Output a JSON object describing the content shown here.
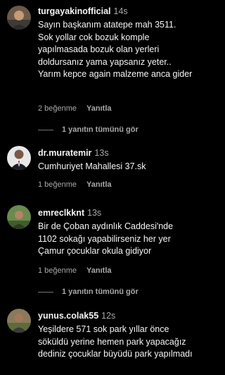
{
  "comments": [
    {
      "username": "turgayakinofficial",
      "time": "14s",
      "text": "Sayın başkanım atatepe mah 3511. Sok yollar cok bozuk komple yapılmasada bozuk olan yerleri doldursanız yama yapsanız yeter.. Yarım kepce again malzeme anca gider",
      "likes": "2 beğenme",
      "reply": "Yanıtla",
      "view_replies": "1 yanıtın tümünü gör"
    },
    {
      "username": "dr.muratemir",
      "time": "13s",
      "text": "Cumhuriyet Mahallesi 37.sk",
      "likes": "1 beğenme",
      "reply": "Yanıtla"
    },
    {
      "username": "emreclkknt",
      "time": "13s",
      "text": "Bir de Çoban aydınlık Caddesi'nde 1102 sokağı yapabilirseniz her yer Çamur çocuklar okula gidiyor",
      "likes": "1 beğenme",
      "reply": "Yanıtla",
      "view_replies": "1 yanıtın tümünü gör"
    },
    {
      "username": "yunus.colak55",
      "time": "12s",
      "text": "Yeşildere 571 sok park yıllar önce söküldü yerine hemen park yapacağız dediniz çocuklar büyüdü park yapılmadı"
    }
  ],
  "colors": {
    "background": "#000000",
    "primary_text": "#f5f5f5",
    "secondary_text": "#a8a8a8"
  }
}
